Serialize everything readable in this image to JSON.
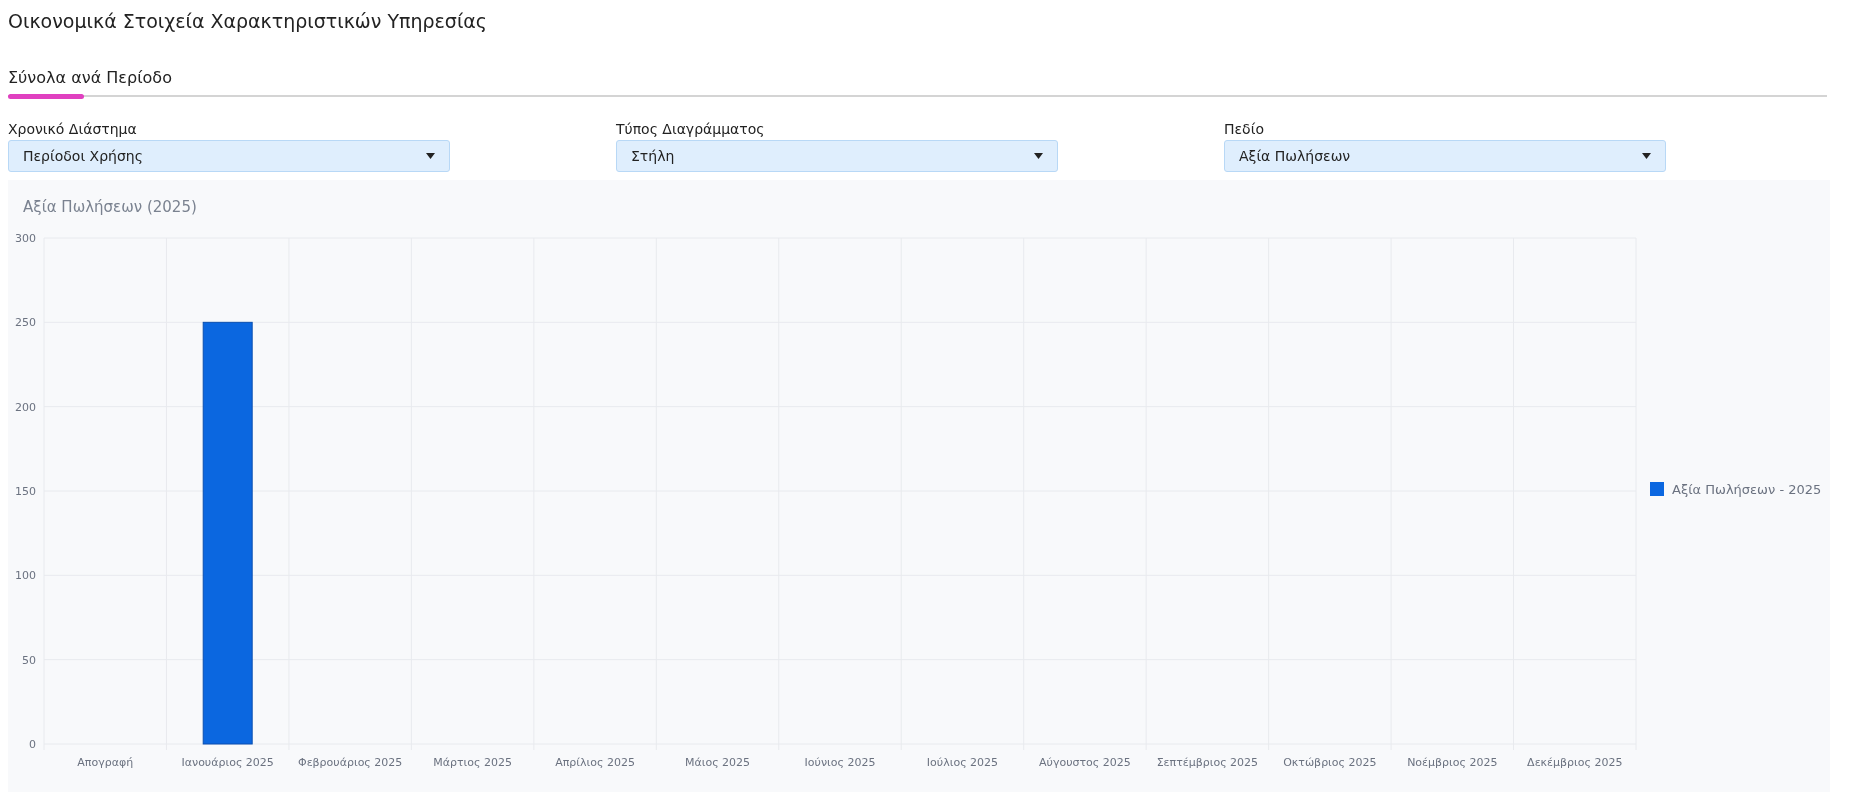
{
  "page_title": "Οικονομικά Στοιχεία Χαρακτηριστικών Υπηρεσίας",
  "tabs": [
    {
      "label": "Σύνολα ανά Περίοδο",
      "selected": true
    }
  ],
  "filters": [
    {
      "label": "Χρονικό Διάστημα",
      "value": "Περίοδοι Χρήσης"
    },
    {
      "label": "Τύπος Διαγράμματος",
      "value": "Στήλη"
    },
    {
      "label": "Πεδίο",
      "value": "Αξία Πωλήσεων"
    }
  ],
  "chart": {
    "title": "Αξία Πωλήσεων (2025)",
    "chart_data": {
      "type": "bar",
      "categories": [
        "Απογραφή",
        "Ιανουάριος 2025",
        "Φεβρουάριος 2025",
        "Μάρτιος 2025",
        "Απρίλιος 2025",
        "Μάιος 2025",
        "Ιούνιος 2025",
        "Ιούλιος 2025",
        "Αύγουστος 2025",
        "Σεπτέμβριος 2025",
        "Οκτώβριος 2025",
        "Νοέμβριος 2025",
        "Δεκέμβριος 2025"
      ],
      "series": [
        {
          "name": "Αξία Πωλήσεων - 2025",
          "color": "#0b67e0",
          "values": [
            0,
            250,
            0,
            0,
            0,
            0,
            0,
            0,
            0,
            0,
            0,
            0,
            0
          ]
        }
      ],
      "grid": true,
      "ylim": [
        0,
        300
      ],
      "yticks": [
        0,
        50,
        100,
        150,
        200,
        250,
        300
      ]
    }
  }
}
